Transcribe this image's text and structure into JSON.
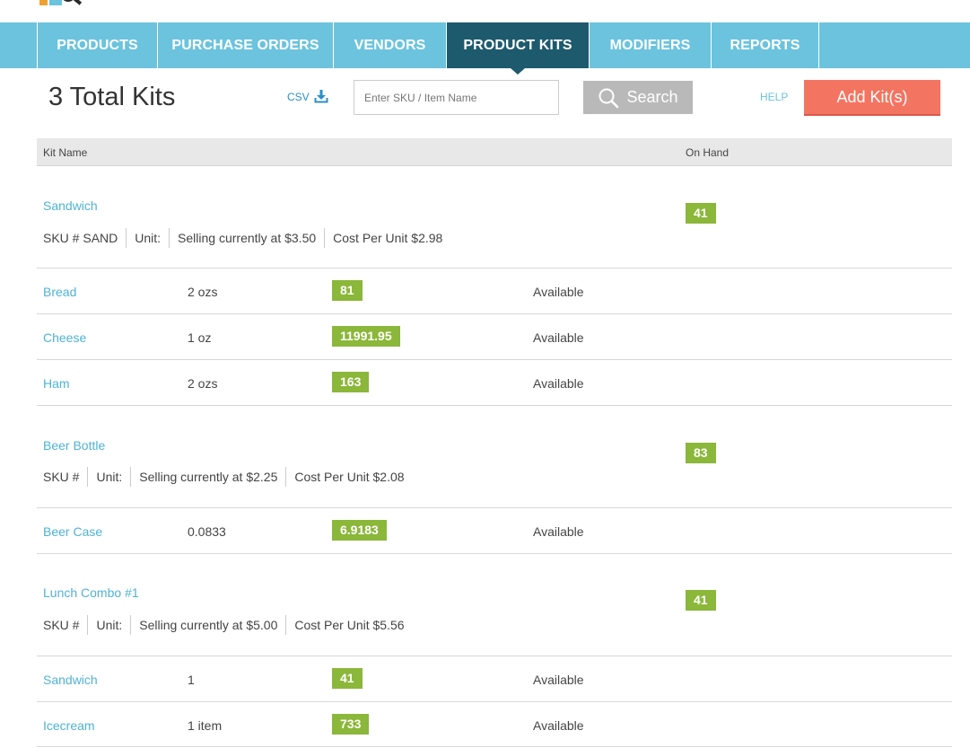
{
  "nav": {
    "tabs": [
      {
        "label": "PRODUCTS",
        "active": false
      },
      {
        "label": "PURCHASE ORDERS",
        "active": false
      },
      {
        "label": "VENDORS",
        "active": false
      },
      {
        "label": "PRODUCT KITS",
        "active": true
      },
      {
        "label": "MODIFIERS",
        "active": false
      },
      {
        "label": "REPORTS",
        "active": false
      }
    ]
  },
  "toolbar": {
    "title": "3 Total Kits",
    "csv_label": "CSV",
    "search_placeholder": "Enter SKU / Item Name",
    "search_label": "Search",
    "help_label": "HELP",
    "add_label": "Add Kit(s)"
  },
  "table": {
    "col_kit_name": "Kit Name",
    "col_on_hand": "On Hand"
  },
  "kits": [
    {
      "name": "Sandwich",
      "sku": "SKU # SAND",
      "unit": "Unit:",
      "selling": "Selling currently at $3.50",
      "cost": "Cost Per Unit $2.98",
      "on_hand": "41",
      "components": [
        {
          "name": "Bread",
          "qty": "2 ozs",
          "stock": "81",
          "status": "Available"
        },
        {
          "name": "Cheese",
          "qty": "1 oz",
          "stock": "11991.95",
          "status": "Available"
        },
        {
          "name": "Ham",
          "qty": "2 ozs",
          "stock": "163",
          "status": "Available"
        }
      ]
    },
    {
      "name": "Beer Bottle",
      "sku": "SKU #",
      "unit": "Unit:",
      "selling": "Selling currently at $2.25",
      "cost": "Cost Per Unit $2.08",
      "on_hand": "83",
      "components": [
        {
          "name": "Beer Case",
          "qty": "0.0833",
          "stock": "6.9183",
          "status": "Available"
        }
      ]
    },
    {
      "name": "Lunch Combo #1",
      "sku": "SKU #",
      "unit": "Unit:",
      "selling": "Selling currently at $5.00",
      "cost": "Cost Per Unit $5.56",
      "on_hand": "41",
      "components": [
        {
          "name": "Sandwich",
          "qty": "1",
          "stock": "41",
          "status": "Available"
        },
        {
          "name": "Icecream",
          "qty": "1 item",
          "stock": "733",
          "status": "Available"
        }
      ]
    }
  ],
  "colors": {
    "nav_bg": "#6cc3de",
    "nav_active": "#1e5a6e",
    "link": "#4fb3d6",
    "badge": "#8bb73a",
    "add_button": "#f47462",
    "search_button": "#b9b9b9"
  }
}
